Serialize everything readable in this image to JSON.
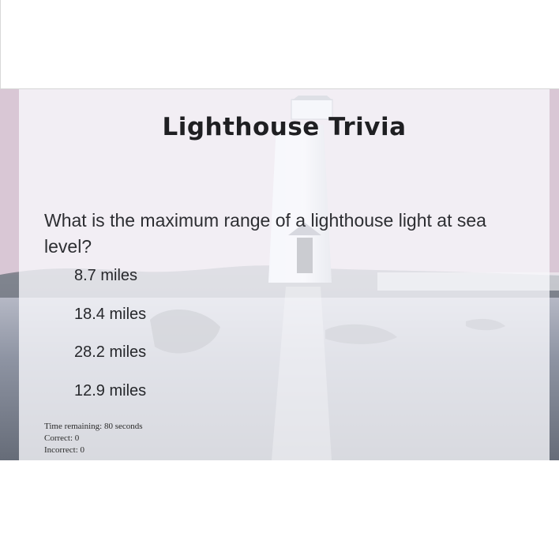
{
  "game": {
    "title": "Lighthouse Trivia",
    "question": "What is the maximum range of a lighthouse light at sea level?",
    "answers": [
      "8.7 miles",
      "18.4 miles",
      "28.2 miles",
      "12.9 miles"
    ],
    "status": {
      "time_remaining": "Time remaining: 80 seconds",
      "correct": "Correct: 0",
      "incorrect": "Incorrect: 0"
    }
  },
  "colors": {
    "panel_tint": "#f8f8fc",
    "text": "#2d2e32",
    "sky_pink": "#d7b7ca",
    "water_gray": "#6e7686"
  }
}
